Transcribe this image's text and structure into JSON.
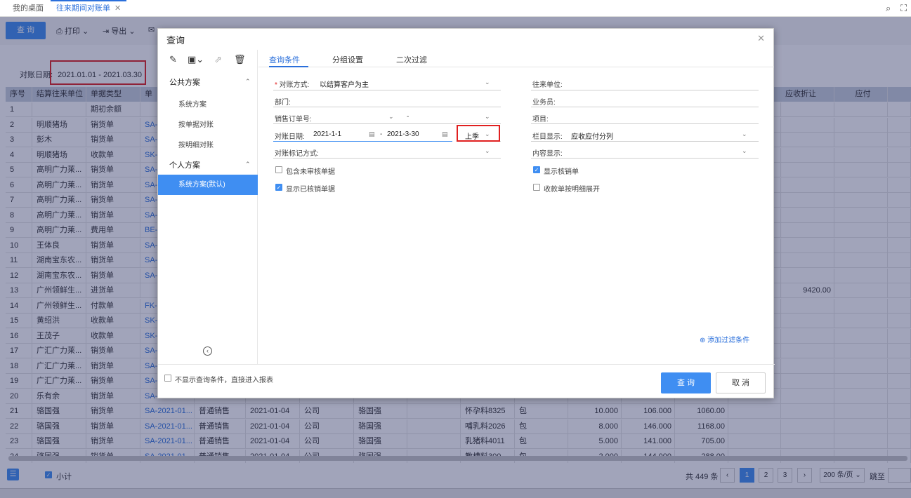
{
  "tabs": [
    "我的桌面",
    "往来期间对账单"
  ],
  "toolbar": {
    "query": "查 询",
    "print": "打印",
    "export": "导出"
  },
  "date_range": {
    "label": "对账日期:",
    "value": "2021.01.01 - 2021.03.30"
  },
  "grid": {
    "columns": [
      "序号",
      "结算往来单位",
      "单据类型",
      "单",
      "应收折让",
      "应付"
    ],
    "rows": [
      {
        "no": "1",
        "unit": "",
        "type": "期初余额",
        "doc": "",
        "c1": "",
        "c2": "",
        "c3": "",
        "c4": "",
        "c5": "",
        "c6": "",
        "c7": "",
        "c8": "",
        "c9": "",
        "c10": "",
        "c11": "",
        "c12": ""
      },
      {
        "no": "2",
        "unit": "明顺猪场",
        "type": "销货单",
        "doc": "SA-",
        "c1": "",
        "c2": "",
        "c3": "",
        "c4": "",
        "c5": "",
        "c6": "",
        "c7": "",
        "c8": "",
        "c9": "",
        "c10": "",
        "c11": "",
        "c12": ""
      },
      {
        "no": "3",
        "unit": "彭木",
        "type": "销货单",
        "doc": "SA-",
        "c1": "",
        "c2": "",
        "c3": "",
        "c4": "",
        "c5": "",
        "c6": "",
        "c7": "",
        "c8": "",
        "c9": "",
        "c10": "",
        "c11": "",
        "c12": ""
      },
      {
        "no": "4",
        "unit": "明顺猪场",
        "type": "收款单",
        "doc": "SK-",
        "c1": "",
        "c2": "",
        "c3": "",
        "c4": "",
        "c5": "",
        "c6": "",
        "c7": "",
        "c8": "",
        "c9": "",
        "c10": "",
        "c11": "",
        "c12": ""
      },
      {
        "no": "5",
        "unit": "高明广力莱...",
        "type": "销货单",
        "doc": "SA-",
        "c1": "",
        "c2": "",
        "c3": "",
        "c4": "",
        "c5": "",
        "c6": "",
        "c7": "",
        "c8": "",
        "c9": "",
        "c10": "",
        "c11": "",
        "c12": ""
      },
      {
        "no": "6",
        "unit": "高明广力莱...",
        "type": "销货单",
        "doc": "SA-",
        "c1": "",
        "c2": "",
        "c3": "",
        "c4": "",
        "c5": "",
        "c6": "",
        "c7": "",
        "c8": "",
        "c9": "",
        "c10": "",
        "c11": "",
        "c12": ""
      },
      {
        "no": "7",
        "unit": "高明广力莱...",
        "type": "销货单",
        "doc": "SA-",
        "c1": "",
        "c2": "",
        "c3": "",
        "c4": "",
        "c5": "",
        "c6": "",
        "c7": "",
        "c8": "",
        "c9": "",
        "c10": "",
        "c11": "",
        "c12": ""
      },
      {
        "no": "8",
        "unit": "高明广力莱...",
        "type": "销货单",
        "doc": "SA-",
        "c1": "",
        "c2": "",
        "c3": "",
        "c4": "",
        "c5": "",
        "c6": "",
        "c7": "",
        "c8": "",
        "c9": "",
        "c10": "",
        "c11": "",
        "c12": ""
      },
      {
        "no": "9",
        "unit": "高明广力莱...",
        "type": "费用单",
        "doc": "BE-",
        "c1": "",
        "c2": "",
        "c3": "",
        "c4": "",
        "c5": "",
        "c6": "",
        "c7": "",
        "c8": "",
        "c9": "",
        "c10": "",
        "c11": "",
        "c12": ""
      },
      {
        "no": "10",
        "unit": "王体良",
        "type": "销货单",
        "doc": "SA-",
        "c1": "",
        "c2": "",
        "c3": "",
        "c4": "",
        "c5": "",
        "c6": "",
        "c7": "",
        "c8": "",
        "c9": "",
        "c10": "",
        "c11": "",
        "c12": ""
      },
      {
        "no": "11",
        "unit": "湖南宝东农...",
        "type": "销货单",
        "doc": "SA-",
        "c1": "",
        "c2": "",
        "c3": "",
        "c4": "",
        "c5": "",
        "c6": "",
        "c7": "",
        "c8": "",
        "c9": "",
        "c10": "",
        "c11": "",
        "c12": ""
      },
      {
        "no": "12",
        "unit": "湖南宝东农...",
        "type": "销货单",
        "doc": "SA-",
        "c1": "",
        "c2": "",
        "c3": "",
        "c4": "",
        "c5": "",
        "c6": "",
        "c7": "",
        "c8": "",
        "c9": "",
        "c10": "",
        "c11": "",
        "c12": ""
      },
      {
        "no": "13",
        "unit": "广州领鲜生...",
        "type": "进货单",
        "doc": "",
        "c1": "",
        "c2": "",
        "c3": "",
        "c4": "",
        "c5": "",
        "c6": "",
        "c7": "",
        "c8": "",
        "c9": "",
        "c10": "",
        "c11": "",
        "c12": "9420.00"
      },
      {
        "no": "14",
        "unit": "广州领鲜生...",
        "type": "付款单",
        "doc": "FK-",
        "c1": "",
        "c2": "",
        "c3": "",
        "c4": "",
        "c5": "",
        "c6": "",
        "c7": "",
        "c8": "",
        "c9": "",
        "c10": "",
        "c11": "",
        "c12": ""
      },
      {
        "no": "15",
        "unit": "黄绍洪",
        "type": "收款单",
        "doc": "SK-",
        "c1": "",
        "c2": "",
        "c3": "",
        "c4": "",
        "c5": "",
        "c6": "",
        "c7": "",
        "c8": "",
        "c9": "",
        "c10": "",
        "c11": "",
        "c12": ""
      },
      {
        "no": "16",
        "unit": "王茂子",
        "type": "收款单",
        "doc": "SK-",
        "c1": "",
        "c2": "",
        "c3": "",
        "c4": "",
        "c5": "",
        "c6": "",
        "c7": "",
        "c8": "",
        "c9": "",
        "c10": "",
        "c11": "",
        "c12": ""
      },
      {
        "no": "17",
        "unit": "广汇广力莱...",
        "type": "销货单",
        "doc": "SA-",
        "c1": "",
        "c2": "",
        "c3": "",
        "c4": "",
        "c5": "",
        "c6": "",
        "c7": "",
        "c8": "",
        "c9": "",
        "c10": "",
        "c11": "",
        "c12": ""
      },
      {
        "no": "18",
        "unit": "广汇广力莱...",
        "type": "销货单",
        "doc": "SA-",
        "c1": "",
        "c2": "",
        "c3": "",
        "c4": "",
        "c5": "",
        "c6": "",
        "c7": "",
        "c8": "",
        "c9": "",
        "c10": "",
        "c11": "",
        "c12": ""
      },
      {
        "no": "19",
        "unit": "广汇广力莱...",
        "type": "销货单",
        "doc": "SA-",
        "c1": "",
        "c2": "",
        "c3": "",
        "c4": "",
        "c5": "",
        "c6": "",
        "c7": "",
        "c8": "",
        "c9": "",
        "c10": "",
        "c11": "",
        "c12": ""
      },
      {
        "no": "20",
        "unit": "乐有余",
        "type": "销货单",
        "doc": "SA-",
        "c1": "",
        "c2": "",
        "c3": "",
        "c4": "",
        "c5": "",
        "c6": "",
        "c7": "",
        "c8": "",
        "c9": "",
        "c10": "",
        "c11": "",
        "c12": ""
      },
      {
        "no": "21",
        "unit": "骆国强",
        "type": "销货单",
        "doc": "SA-2021-01...",
        "c1": "普通销售",
        "c2": "2021-01-04",
        "c3": "公司",
        "c4": "骆国强",
        "c5": "",
        "c6": "怀孕料8325",
        "c7": "包",
        "c8": "10.000",
        "c9": "106.000",
        "c10": "1060.00",
        "c11": "",
        "c12": ""
      },
      {
        "no": "22",
        "unit": "骆国强",
        "type": "销货单",
        "doc": "SA-2021-01...",
        "c1": "普通销售",
        "c2": "2021-01-04",
        "c3": "公司",
        "c4": "骆国强",
        "c5": "",
        "c6": "哺乳料2026",
        "c7": "包",
        "c8": "8.000",
        "c9": "146.000",
        "c10": "1168.00",
        "c11": "",
        "c12": ""
      },
      {
        "no": "23",
        "unit": "骆国强",
        "type": "销货单",
        "doc": "SA-2021-01...",
        "c1": "普通销售",
        "c2": "2021-01-04",
        "c3": "公司",
        "c4": "骆国强",
        "c5": "",
        "c6": "乳猪料4011",
        "c7": "包",
        "c8": "5.000",
        "c9": "141.000",
        "c10": "705.00",
        "c11": "",
        "c12": ""
      },
      {
        "no": "24",
        "unit": "骆国强",
        "type": "销货单",
        "doc": "SA-2021-01...",
        "c1": "普通销售",
        "c2": "2021-01-04",
        "c3": "公司",
        "c4": "骆国强",
        "c5": "",
        "c6": "教槽料300",
        "c7": "包",
        "c8": "2.000",
        "c9": "144.000",
        "c10": "288.00",
        "c11": "",
        "c12": ""
      }
    ]
  },
  "footer": {
    "subtotal": "小计",
    "total": "共 449 条",
    "pages": [
      "1",
      "2",
      "3"
    ],
    "page_size": "200 条/页",
    "jump": "跳至"
  },
  "dialog": {
    "title": "查询",
    "sidebar": {
      "public_group": "公共方案",
      "public_items": [
        "系统方案",
        "按单据对账",
        "按明细对账"
      ],
      "personal_group": "个人方案",
      "personal_selected": "系统方案(默认)"
    },
    "tabs": [
      "查询条件",
      "分组设置",
      "二次过滤"
    ],
    "form": {
      "recon_method_label": "对账方式:",
      "recon_method_value": "以结算客户为主",
      "unit_label": "往来单位:",
      "dept_label": "部门:",
      "salesman_label": "业务员:",
      "order_label": "销售订单号:",
      "order_sep": "-",
      "project_label": "项目:",
      "date_label": "对账日期:",
      "date_from": "2021-1-1",
      "date_sep": "-",
      "date_to": "2021-3-30",
      "period": "上季",
      "column_label": "栏目显示:",
      "column_value": "应收应付分列",
      "mark_label": "对账标记方式:",
      "content_label": "内容显示:",
      "cb_unreviewed": "包含未审核单据",
      "cb_show_writeoff": "显示核销单",
      "cb_show_writtenoff": "显示已核销单据",
      "cb_receipt_detail": "收款单按明细展开"
    },
    "add_filter": "添加过滤条件",
    "skip_label": "不显示查询条件，直接进入报表",
    "ok": "查 询",
    "cancel": "取 消"
  }
}
